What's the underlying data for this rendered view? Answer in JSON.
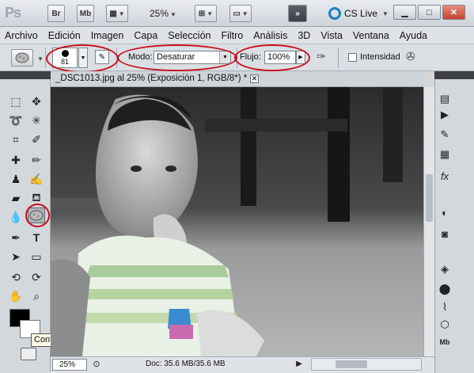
{
  "app": {
    "logo": "Ps",
    "bridge_label": "Br",
    "minibridge_label": "Mb",
    "zoom": "25%",
    "cs_live": "CS Live"
  },
  "menu": [
    "Archivo",
    "Edición",
    "Imagen",
    "Capa",
    "Selección",
    "Filtro",
    "Análisis",
    "3D",
    "Vista",
    "Ventana",
    "Ayuda"
  ],
  "options": {
    "brush_size": "81",
    "mode_label": "Modo:",
    "mode_value": "Desaturar",
    "flow_label": "Flujo:",
    "flow_value": "100%",
    "intensity_label": "Intensidad"
  },
  "document": {
    "tab_title": "_DSC1013.jpg al 25% (Exposición 1, RGB/8*) *",
    "status_zoom": "25%",
    "status_info": "Doc: 35.6 MB/35.6 MB"
  },
  "tooltip": "Configurar color de fondo",
  "colors": {
    "highlight_ring": "#c8101e",
    "foreground": "#000000",
    "background": "#ffffff"
  }
}
